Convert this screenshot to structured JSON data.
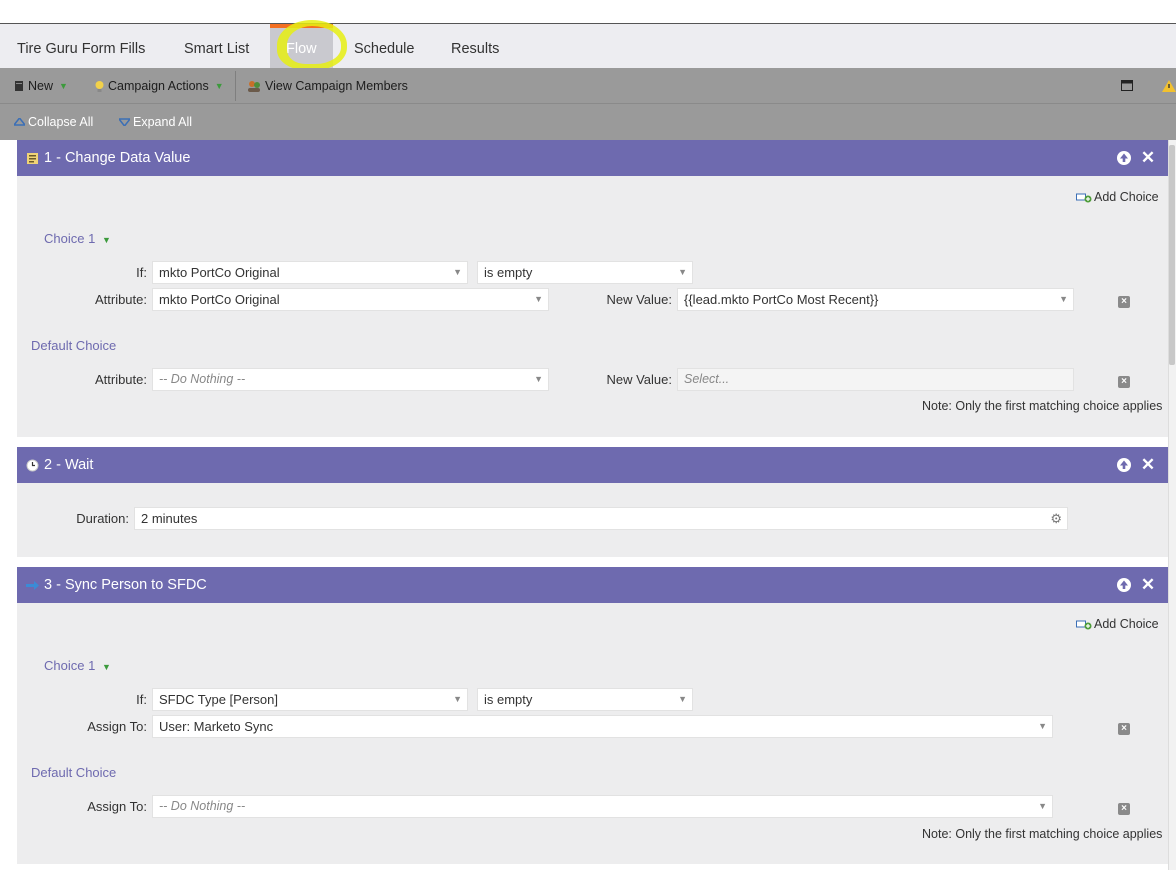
{
  "tabs": [
    "Tire Guru Form Fills",
    "Smart List",
    "Flow",
    "Schedule",
    "Results"
  ],
  "toolbar": {
    "new_label": "New",
    "campaign_actions_label": "Campaign Actions",
    "view_members_label": "View Campaign Members"
  },
  "subbar": {
    "collapse_label": "Collapse All",
    "expand_label": "Expand All"
  },
  "steps": [
    {
      "title": "1 - Change Data Value",
      "add_choice": "Add Choice",
      "choice_label": "Choice 1",
      "if_label": "If:",
      "if_field": "mkto PortCo Original",
      "if_operator": "is empty",
      "attr_label": "Attribute:",
      "attr_value": "mkto PortCo Original",
      "newval_label": "New Value:",
      "newval_value": "{{lead.mkto PortCo Most Recent}}",
      "default_label": "Default Choice",
      "default_attr_label": "Attribute:",
      "default_attr_value": "-- Do Nothing --",
      "default_newval_label": "New Value:",
      "default_newval_placeholder": "Select...",
      "note": "Note: Only the first matching choice applies"
    },
    {
      "title": "2 - Wait",
      "duration_label": "Duration:",
      "duration_value": "2 minutes"
    },
    {
      "title": "3 - Sync Person to SFDC",
      "add_choice": "Add Choice",
      "choice_label": "Choice 1",
      "if_label": "If:",
      "if_field": "SFDC Type [Person]",
      "if_operator": "is empty",
      "assign_label": "Assign To:",
      "assign_value": "User: Marketo Sync",
      "default_label": "Default Choice",
      "default_assign_label": "Assign To:",
      "default_assign_value": "-- Do Nothing --",
      "note": "Note: Only the first matching choice applies"
    }
  ]
}
